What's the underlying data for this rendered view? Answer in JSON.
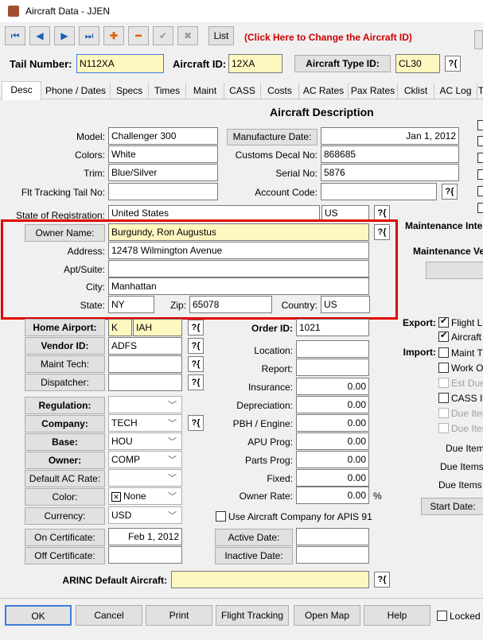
{
  "window": {
    "title": "Aircraft Data - JJEN"
  },
  "toolbar": {
    "list_label": "List",
    "change_aircraft_link": "(Click Here to Change the Aircraft ID)",
    "first": "⏮",
    "prev": "◀",
    "next": "▶",
    "last": "⏭",
    "add": "✚",
    "remove": "━",
    "accept": "✔",
    "cancel": "✖"
  },
  "header": {
    "tail_label": "Tail Number:",
    "tail_value": "N112XA",
    "aircraft_id_label": "Aircraft ID:",
    "aircraft_id_value": "12XA",
    "type_button": "Aircraft Type ID:",
    "type_value": "CL30"
  },
  "tabs": [
    "Desc",
    "Phone / Dates",
    "Specs",
    "Times",
    "Maint",
    "CASS",
    "Costs",
    "AC Rates",
    "Pax Rates",
    "Cklist",
    "AC Log",
    "T"
  ],
  "section_title": "Aircraft Description",
  "desc": {
    "model_label": "Model:",
    "model": "Challenger 300",
    "colors_label": "Colors:",
    "colors": "White",
    "trim_label": "Trim:",
    "trim": "Blue/Silver",
    "flt_label": "Flt Tracking Tail No:",
    "flt": "",
    "mfg_button": "Manufacture Date:",
    "mfg": "Jan 1, 2012",
    "decal_label": "Customs Decal No:",
    "decal": "868685",
    "serial_label": "Serial No:",
    "serial": "5876",
    "account_label": "Account Code:",
    "account": "",
    "state_reg_label": "State of Registration:",
    "state_reg": "United States",
    "state_reg_code": "US"
  },
  "owner": {
    "name_button": "Owner Name:",
    "name": "Burgundy, Ron Augustus",
    "address_label": "Address:",
    "address": "12478 Wilmington Avenue",
    "apt_label": "Apt/Suite:",
    "apt": "",
    "city_label": "City:",
    "city": "Manhattan",
    "state_label": "State:",
    "state": "NY",
    "zip_label": "Zip:",
    "zip": "65078",
    "country_label": "Country:",
    "country": "US"
  },
  "left": {
    "home_airport": "Home Airport:",
    "home_k": "K",
    "home_code": "IAH",
    "vendor": "Vendor ID:",
    "vendor_val": "ADFS",
    "maint_tech": "Maint Tech:",
    "dispatcher": "Dispatcher:",
    "regulation": "Regulation:",
    "company": "Company:",
    "company_val": "TECH",
    "base": "Base:",
    "base_val": "HOU",
    "owner": "Owner:",
    "owner_val": "COMP",
    "default_rate": "Default AC Rate:",
    "color": "Color:",
    "color_val": "None",
    "currency": "Currency:",
    "currency_val": "USD",
    "on_cert": "On Certificate:",
    "on_cert_val": "Feb 1, 2012",
    "off_cert": "Off Certificate:"
  },
  "mid": {
    "order_label": "Order ID:",
    "order": "1021",
    "location": "Location:",
    "report": "Report:",
    "insurance": "Insurance:",
    "insurance_val": "0.00",
    "depreciation": "Depreciation:",
    "depreciation_val": "0.00",
    "pbh": "PBH / Engine:",
    "pbh_val": "0.00",
    "apu": "APU Prog:",
    "apu_val": "0.00",
    "parts": "Parts Prog:",
    "parts_val": "0.00",
    "fixed": "Fixed:",
    "fixed_val": "0.00",
    "owner_rate": "Owner Rate:",
    "owner_rate_val": "0.00",
    "pct": "%",
    "apis": "Use Aircraft Company for APIS 91",
    "active": "Active Date:",
    "inactive": "Inactive Date:"
  },
  "arinc": {
    "label": "ARINC Default Aircraft:",
    "value": ""
  },
  "right": {
    "maint_int": "Maintenance Inte",
    "maint_ver": "Maintenance Ve",
    "export": "Export:",
    "flight_l": "Flight L",
    "aircraft": "Aircraft",
    "import": "Import:",
    "maint_t": "Maint T",
    "work_o": "Work O",
    "est_due": "Est Due",
    "cass_ite": "CASS Ite",
    "due_iter1": "Due Iter",
    "due_iter2": "Due Iter",
    "due_item": "Due Item",
    "due_items1": "Due Items",
    "due_items2": "Due Items",
    "start_date": "Start Date:"
  },
  "footer": {
    "ok": "OK",
    "cancel": "Cancel",
    "print": "Print",
    "flight_tracking": "Flight Tracking",
    "open_map": "Open Map",
    "help": "Help",
    "locked": "Locked"
  },
  "icons": {
    "lookup": "?{"
  },
  "colors": {
    "accent": "#cc0000",
    "highlight": "#fff7c0",
    "selection_border": "#e00000"
  }
}
